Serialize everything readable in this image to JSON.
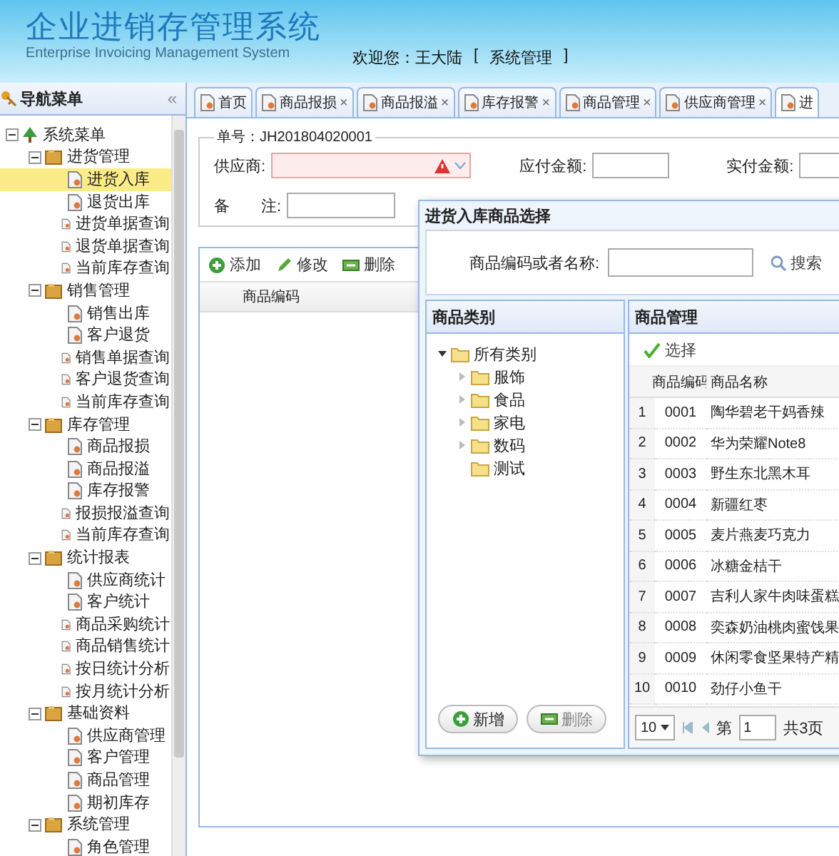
{
  "header": {
    "title": "企业进销存管理系统",
    "subtitle": "Enterprise Invoicing Management System",
    "welcome": "欢迎您：王大陆",
    "bracket_open": "[",
    "link": "系统管理",
    "bracket_close": "]"
  },
  "sidebar": {
    "title": "导航菜单",
    "collapse": "«",
    "tree": [
      {
        "label": "系统菜单",
        "expanded": true,
        "selected": false,
        "children": [
          {
            "label": "进货管理",
            "expanded": true,
            "selected": false,
            "children": [
              {
                "label": "进货入库",
                "selected": true
              },
              {
                "label": "退货出库",
                "selected": false
              },
              {
                "label": "进货单据查询",
                "selected": false
              },
              {
                "label": "退货单据查询",
                "selected": false
              },
              {
                "label": "当前库存查询",
                "selected": false
              }
            ]
          },
          {
            "label": "销售管理",
            "expanded": true,
            "selected": false,
            "children": [
              {
                "label": "销售出库",
                "selected": false
              },
              {
                "label": "客户退货",
                "selected": false
              },
              {
                "label": "销售单据查询",
                "selected": false
              },
              {
                "label": "客户退货查询",
                "selected": false
              },
              {
                "label": "当前库存查询",
                "selected": false
              }
            ]
          },
          {
            "label": "库存管理",
            "expanded": true,
            "selected": false,
            "children": [
              {
                "label": "商品报损",
                "selected": false
              },
              {
                "label": "商品报溢",
                "selected": false
              },
              {
                "label": "库存报警",
                "selected": false
              },
              {
                "label": "报损报溢查询",
                "selected": false
              },
              {
                "label": "当前库存查询",
                "selected": false
              }
            ]
          },
          {
            "label": "统计报表",
            "expanded": true,
            "selected": false,
            "children": [
              {
                "label": "供应商统计",
                "selected": false
              },
              {
                "label": "客户统计",
                "selected": false
              },
              {
                "label": "商品采购统计",
                "selected": false
              },
              {
                "label": "商品销售统计",
                "selected": false
              },
              {
                "label": "按日统计分析",
                "selected": false
              },
              {
                "label": "按月统计分析",
                "selected": false
              }
            ]
          },
          {
            "label": "基础资料",
            "expanded": true,
            "selected": false,
            "children": [
              {
                "label": "供应商管理",
                "selected": false
              },
              {
                "label": "客户管理",
                "selected": false
              },
              {
                "label": "商品管理",
                "selected": false
              },
              {
                "label": "期初库存",
                "selected": false
              }
            ]
          },
          {
            "label": "系统管理",
            "expanded": true,
            "selected": false,
            "children": [
              {
                "label": "角色管理",
                "selected": false
              }
            ]
          }
        ]
      }
    ]
  },
  "tabs": [
    {
      "label": "首页",
      "selected": false
    },
    {
      "label": "商品报损",
      "close": "×",
      "selected": false
    },
    {
      "label": "商品报溢",
      "close": "×",
      "selected": false
    },
    {
      "label": "库存报警",
      "close": "×",
      "selected": false
    },
    {
      "label": "商品管理",
      "close": "×",
      "selected": false
    },
    {
      "label": "供应商管理",
      "close": "×",
      "selected": false
    },
    {
      "label": "进",
      "selected": true
    }
  ],
  "form": {
    "legend": "单号：JH201804020001",
    "fields": [
      {
        "label": "供应商:",
        "kind": "combo",
        "invalid": true
      },
      {
        "label": "应付金额:",
        "kind": "text",
        "invalid": false
      },
      {
        "label": "实付金额:",
        "kind": "text",
        "invalid": false
      },
      {
        "label": "备　　注:",
        "kind": "text",
        "invalid": false
      }
    ]
  },
  "grid": {
    "buttons": [
      {
        "label": "添加",
        "kind": "add"
      },
      {
        "label": "修改",
        "kind": "edit"
      },
      {
        "label": "删除",
        "kind": "delete"
      }
    ],
    "columns": [
      "商品编码"
    ]
  },
  "dialog": {
    "title": "进货入库商品选择",
    "search_label": "商品编码或者名称:",
    "search_button": "搜索",
    "category_title": "商品类别",
    "categories": [
      {
        "label": "所有类别",
        "expanded": true,
        "children": [
          {
            "label": "服饰",
            "expanded": false
          },
          {
            "label": "食品",
            "expanded": false
          },
          {
            "label": "家电",
            "expanded": false
          },
          {
            "label": "数码",
            "expanded": false
          },
          {
            "label": "测试"
          }
        ]
      }
    ],
    "category_buttons": [
      {
        "label": "新增",
        "kind": "add",
        "disabled": false
      },
      {
        "label": "删除",
        "kind": "delete",
        "disabled": true
      }
    ],
    "product_title": "商品管理",
    "select_button": "选择",
    "columns": [
      "商品编码",
      "商品名称"
    ],
    "rows": [
      {
        "no": "1",
        "code": "0001",
        "name": "陶华碧老干妈香辣"
      },
      {
        "no": "2",
        "code": "0002",
        "name": "华为荣耀Note8"
      },
      {
        "no": "3",
        "code": "0003",
        "name": "野生东北黑木耳"
      },
      {
        "no": "4",
        "code": "0004",
        "name": "新疆红枣"
      },
      {
        "no": "5",
        "code": "0005",
        "name": "麦片燕麦巧克力"
      },
      {
        "no": "6",
        "code": "0006",
        "name": "冰糖金桔干"
      },
      {
        "no": "7",
        "code": "0007",
        "name": "吉利人家牛肉味蛋糕"
      },
      {
        "no": "8",
        "code": "0008",
        "name": "奕森奶油桃肉蜜饯果"
      },
      {
        "no": "9",
        "code": "0009",
        "name": "休闲零食坚果特产精"
      },
      {
        "no": "10",
        "code": "0010",
        "name": "劲仔小鱼干"
      }
    ],
    "pager": {
      "page_size": "10",
      "page_label": "第",
      "page": "1",
      "total": "共3页"
    }
  }
}
